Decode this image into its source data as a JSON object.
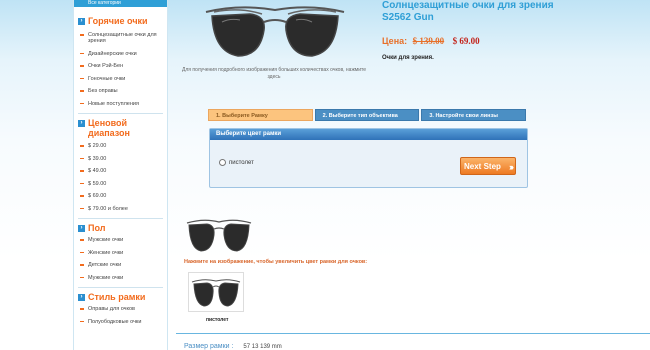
{
  "sidebar": {
    "top_label": "Все категории",
    "sections": [
      {
        "title": "Горячие очки",
        "items": [
          "Солнцезащитные очки для зрения",
          "Дизайнерские очки",
          "Очки Рэй-Бен",
          "Гоночные очки",
          "Без оправы",
          "Новые поступления"
        ]
      },
      {
        "title": "Ценовой диапазон",
        "items": [
          "$ 29.00",
          "$ 39.00",
          "$ 49.00",
          "$ 59.00",
          "$ 69.00",
          "$ 79.00 и более"
        ]
      },
      {
        "title": "Пол",
        "items": [
          "Мужские очки",
          "Женские очки",
          "Детские очки",
          "Мужские очки"
        ]
      },
      {
        "title": "Стиль рамки",
        "items": [
          "Оправы для очков",
          "Полуободковые очки"
        ]
      }
    ]
  },
  "product": {
    "title": "Солнцезащитные очки для зрения S2562 Gun",
    "price_label": "Цена:",
    "price_old": "$ 139.00",
    "price_new": "$ 69.00",
    "description": "Очки для зрения.",
    "image_caption": "Для получения подробного изображения больших количествах очков, нажмите здесь"
  },
  "steps": [
    {
      "label": "1. Выберите Рамку",
      "active": true
    },
    {
      "label": "2. Выберите тип объектива",
      "active": false
    },
    {
      "label": "3. Настройте свои линзы",
      "active": false
    }
  ],
  "frame_panel": {
    "title": "Выберите цвет рамки",
    "option_label": "пистолет",
    "next_label": "Next Step"
  },
  "thumbnails": {
    "hint": "Нажмите на изображение, чтобы увеличить цвет рамки для очков:",
    "label": "пистолет"
  },
  "size": {
    "label": "Размер рамки :",
    "value": "57 13 139 mm"
  },
  "colors": {
    "accent_blue": "#2f9fd6",
    "accent_orange": "#f26b1d",
    "price_red": "#c3241b"
  }
}
